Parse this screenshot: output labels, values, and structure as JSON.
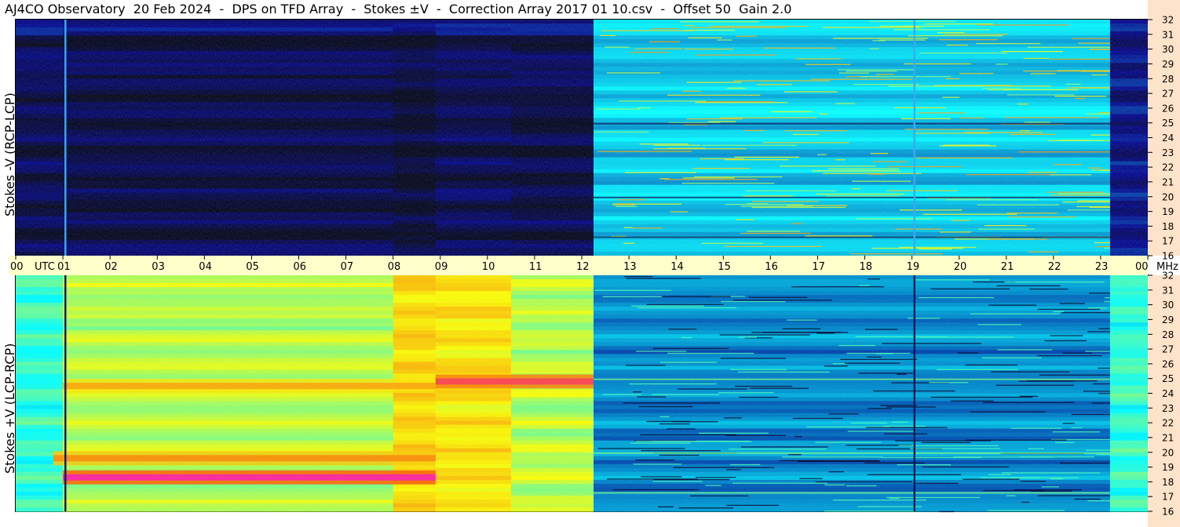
{
  "title": "AJ4CO Observatory  20 Feb 2024  -  DPS on TFD Array  -  Stokes ±V  -  Correction Array 2017 01 10.csv  -  Offset 50  Gain 2.0",
  "colors": {
    "page_bg": "#ffffff",
    "axis_band": "#ffffcc",
    "freq_band": "#fde3c9"
  },
  "chart_data": [
    {
      "type": "heatmap",
      "panel": "top",
      "ylabel": "Stokes -V (RCP-LCP)",
      "x_unit": "UTC",
      "xlim": [
        0,
        24
      ],
      "y_unit": "MHz",
      "ylim": [
        16,
        32
      ],
      "y_ticks": [
        "16",
        "17",
        "18",
        "19",
        "20",
        "21",
        "22",
        "23",
        "24",
        "25",
        "26",
        "27",
        "28",
        "29",
        "30",
        "31",
        "32"
      ],
      "colormap": "jet",
      "segments": [
        {
          "x_start": 0.0,
          "x_end": 1.0,
          "level": 0.05
        },
        {
          "x_start": 1.0,
          "x_end": 8.0,
          "level": 0.04
        },
        {
          "x_start": 8.0,
          "x_end": 8.9,
          "level": 0.02
        },
        {
          "x_start": 8.9,
          "x_end": 10.5,
          "level": 0.05
        },
        {
          "x_start": 10.5,
          "x_end": 12.25,
          "level": 0.04
        },
        {
          "x_start": 12.25,
          "x_end": 23.2,
          "level": 0.32
        },
        {
          "x_start": 23.2,
          "x_end": 24.0,
          "level": 0.12
        }
      ],
      "vertical_lines_utc": [
        1.05,
        19.05
      ]
    },
    {
      "type": "heatmap",
      "panel": "bottom",
      "ylabel": "Stokes +V (LCP-RCP)",
      "x_unit": "UTC",
      "xlim": [
        0,
        24
      ],
      "y_unit": "MHz",
      "ylim": [
        16,
        32
      ],
      "y_ticks": [
        "16",
        "17",
        "18",
        "19",
        "20",
        "21",
        "22",
        "23",
        "24",
        "25",
        "26",
        "27",
        "28",
        "29",
        "30",
        "31",
        "32"
      ],
      "colormap": "jet",
      "segments": [
        {
          "x_start": 0.0,
          "x_end": 1.0,
          "level": 0.42
        },
        {
          "x_start": 1.0,
          "x_end": 8.0,
          "level": 0.55
        },
        {
          "x_start": 8.0,
          "x_end": 8.9,
          "level": 0.68
        },
        {
          "x_start": 8.9,
          "x_end": 10.5,
          "level": 0.66
        },
        {
          "x_start": 10.5,
          "x_end": 12.25,
          "level": 0.56
        },
        {
          "x_start": 12.25,
          "x_end": 23.2,
          "level": 0.26
        },
        {
          "x_start": 23.2,
          "x_end": 24.0,
          "level": 0.42
        }
      ],
      "hot_bands": [
        {
          "mhz": 18.3,
          "x_start": 1.0,
          "x_end": 8.9,
          "level": 0.97
        },
        {
          "mhz": 19.6,
          "x_start": 0.8,
          "x_end": 8.9,
          "level": 0.8
        },
        {
          "mhz": 24.8,
          "x_start": 8.9,
          "x_end": 12.25,
          "level": 0.92
        },
        {
          "mhz": 24.5,
          "x_start": 1.0,
          "x_end": 8.9,
          "level": 0.76
        }
      ],
      "vertical_lines_utc": [
        1.05,
        19.05
      ]
    }
  ],
  "time_axis": {
    "unit": "UTC",
    "end_unit": "MHz",
    "labels": [
      "00",
      "01",
      "02",
      "03",
      "04",
      "05",
      "06",
      "07",
      "08",
      "09",
      "10",
      "11",
      "12",
      "13",
      "14",
      "15",
      "16",
      "17",
      "18",
      "19",
      "20",
      "21",
      "22",
      "23",
      "00"
    ]
  }
}
